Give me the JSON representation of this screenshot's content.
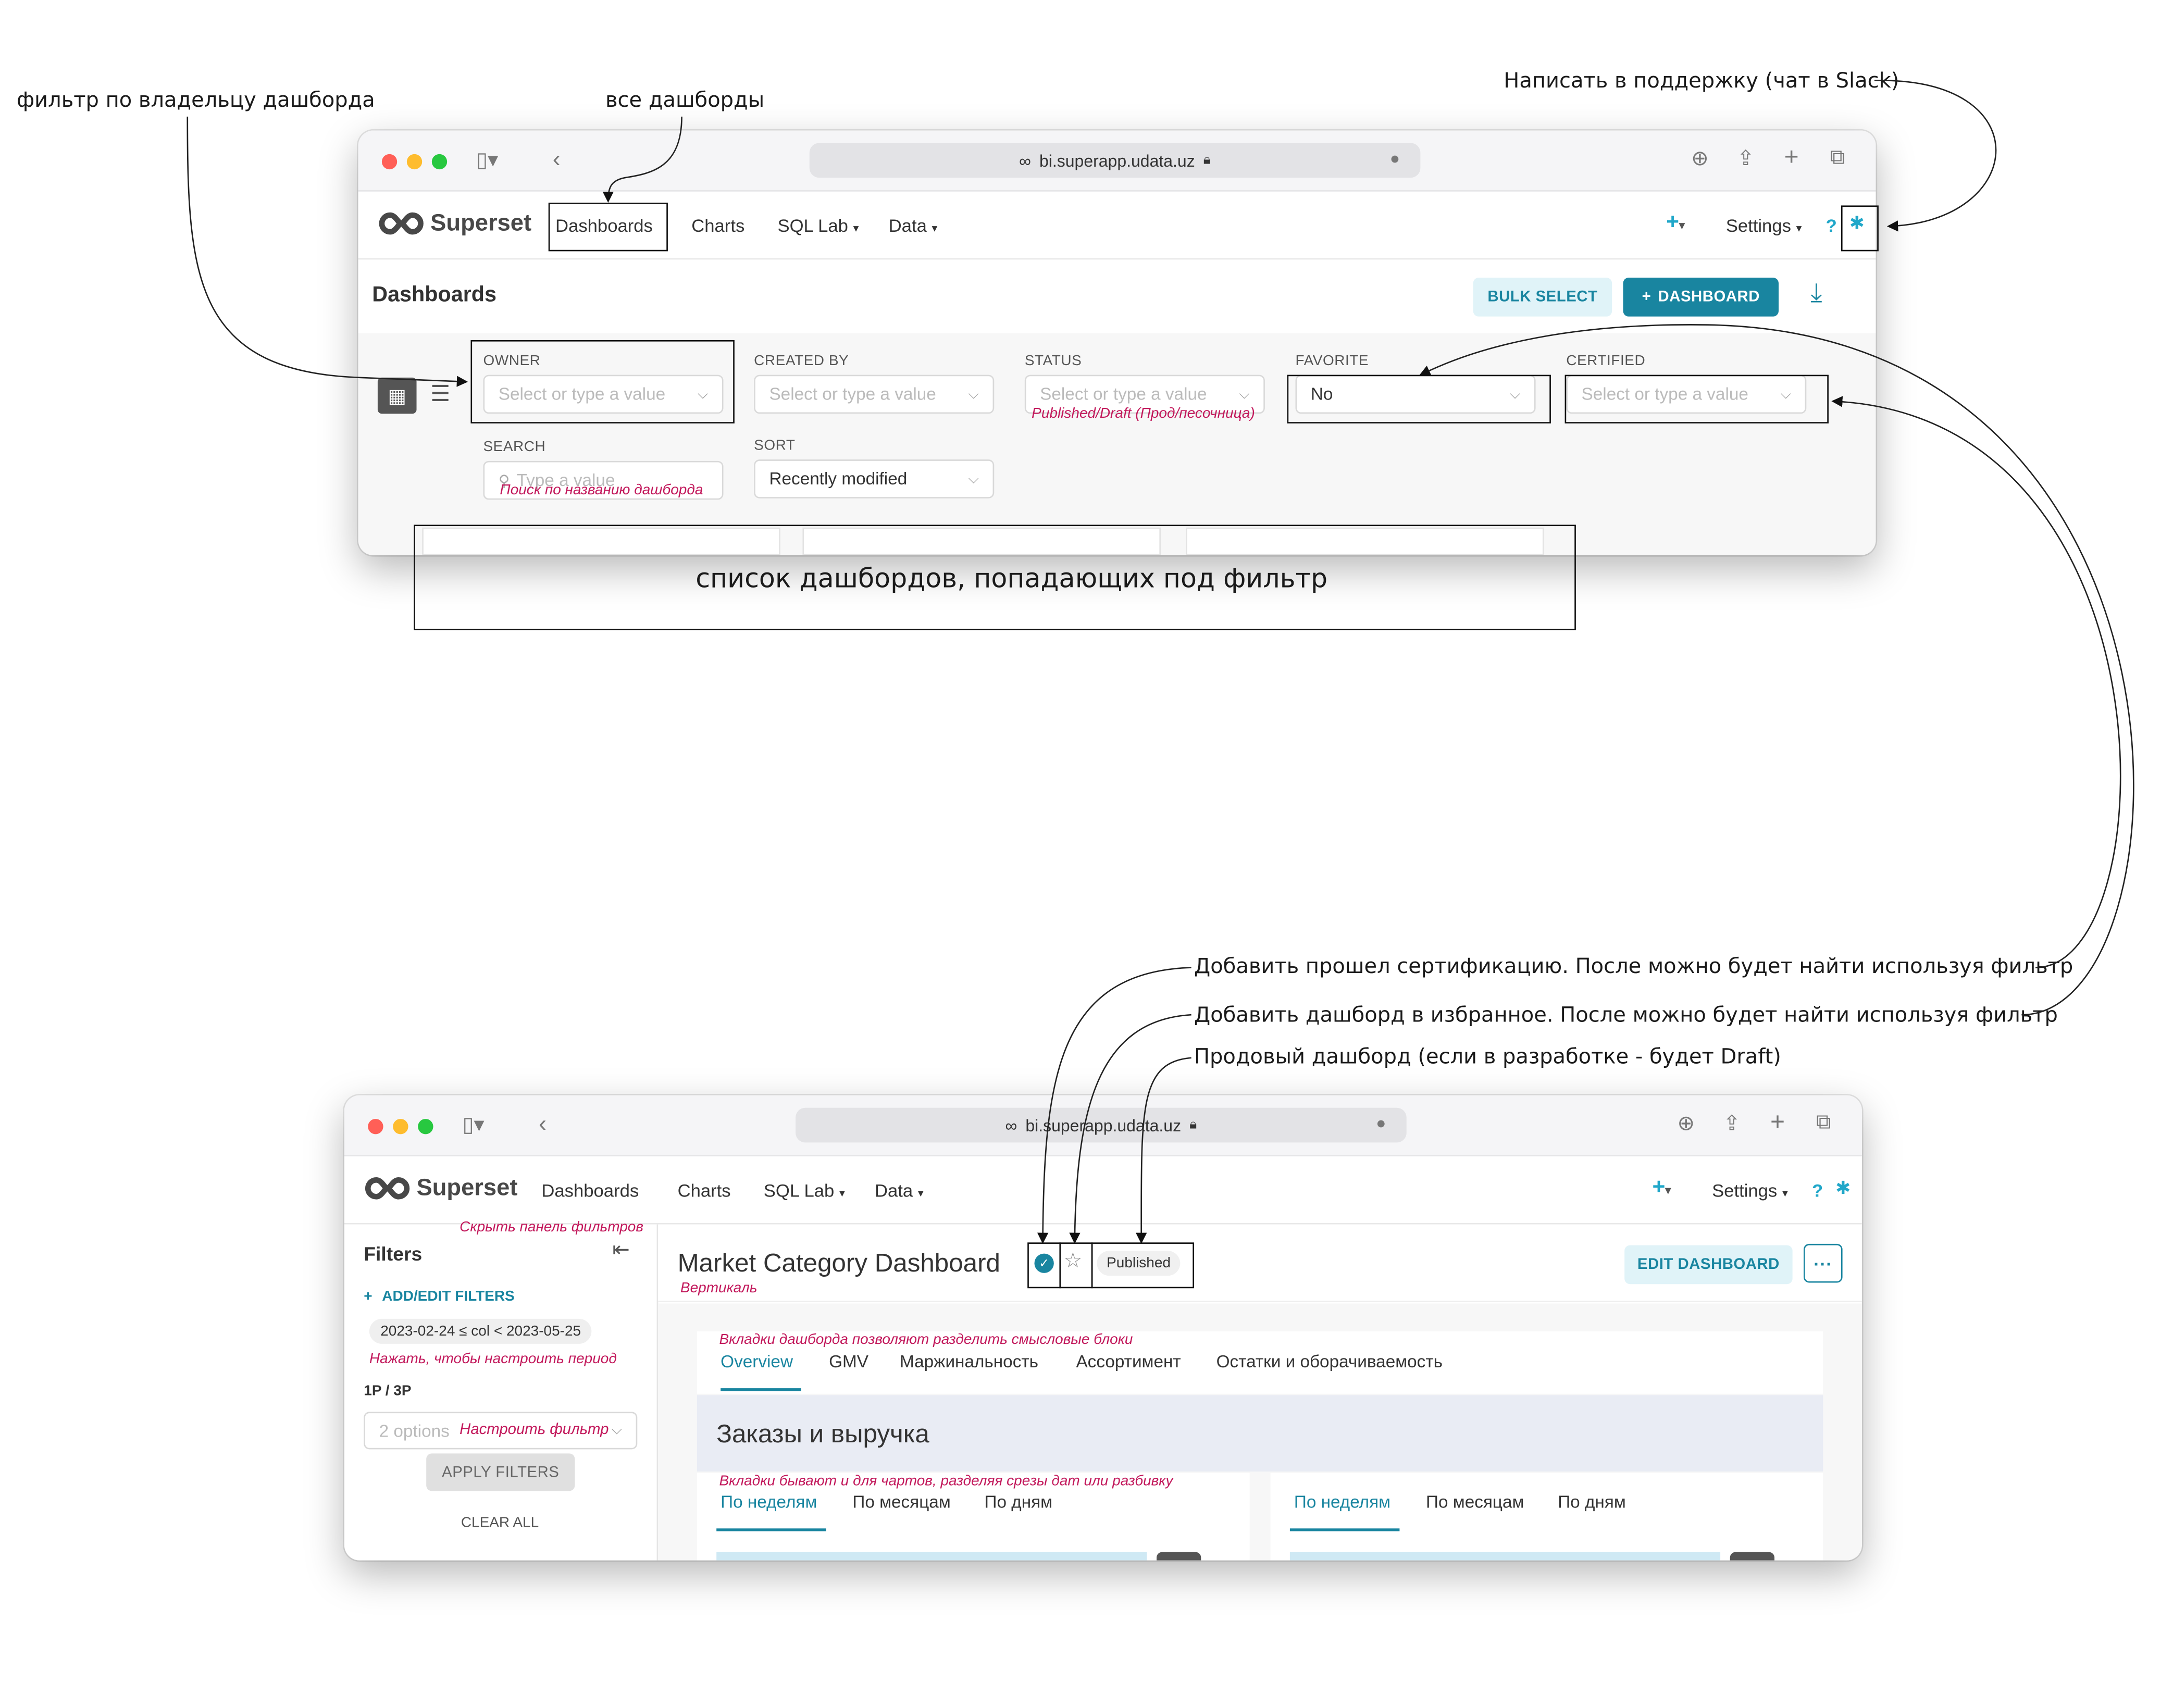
{
  "annotations": {
    "owner_filter": "фильтр по владельцу дашборда",
    "all_dashboards": "все дашборды",
    "support": "Написать в поддержку (чат в Slack)",
    "dashboard_list": "список дашбордов, попадающих под фильтр",
    "certified_add": "Добавить прошел сертификацию. После можно будет найти используя фильтр",
    "favorite_add": "Добавить дашборд в избранное. После можно будет найти используя фильтр",
    "published": "Продовый дашборд (если в разработке - будет Draft)"
  },
  "browser": {
    "url": "bi.superapp.udata.uz"
  },
  "nav": {
    "logo": "Superset",
    "dashboards": "Dashboards",
    "charts": "Charts",
    "sql_lab": "SQL Lab",
    "data": "Data",
    "settings": "Settings",
    "help": "?"
  },
  "list_page": {
    "title": "Dashboards",
    "bulk_select": "BULK SELECT",
    "add_dashboard": "DASHBOARD",
    "filters": {
      "owner": {
        "label": "OWNER",
        "placeholder": "Select or type a value"
      },
      "created_by": {
        "label": "CREATED BY",
        "placeholder": "Select or type a value"
      },
      "status": {
        "label": "STATUS",
        "placeholder": "Select or type a value",
        "note": "Published/Draft (Прод/песочница)"
      },
      "favorite": {
        "label": "FAVORITE",
        "value": "No"
      },
      "certified": {
        "label": "CERTIFIED",
        "placeholder": "Select or type a value"
      },
      "search": {
        "label": "SEARCH",
        "placeholder": "Type a value",
        "note": "Поиск по названию дашборда"
      },
      "sort": {
        "label": "SORT",
        "value": "Recently modified"
      }
    }
  },
  "dash_page": {
    "filters_title": "Filters",
    "hide_panel_note": "Скрыть панель фильтров",
    "add_edit_filters": "ADD/EDIT FILTERS",
    "time_chip": "2023-02-24 ≤ col < 2023-05-25",
    "time_note": "Нажать, чтобы настроить период",
    "filter_1p3p": "1P / 3P",
    "options_placeholder": "2 options",
    "options_note": "Настроить фильтр",
    "apply_filters": "APPLY FILTERS",
    "clear_all": "CLEAR ALL",
    "title": "Market Category Dashboard",
    "title_note": "Вертикаль",
    "status_badge": "Published",
    "edit_dashboard": "EDIT DASHBOARD",
    "more": "···",
    "tabs_note": "Вкладки дашборда позволяют разделить смысловые блоки",
    "tabs": [
      "Overview",
      "GMV",
      "Маржинальность",
      "Ассортимент",
      "Остатки и оборачиваемость"
    ],
    "section_title": "Заказы и выручка",
    "chart_tabs_note": "Вкладки бывают и для чартов, разделяя срезы дат или разбивку",
    "chart_tabs_left": [
      "По неделям",
      "По месяцам",
      "По дням"
    ],
    "chart_tabs_right": [
      "По неделям",
      "По месяцам",
      "По дням"
    ]
  }
}
